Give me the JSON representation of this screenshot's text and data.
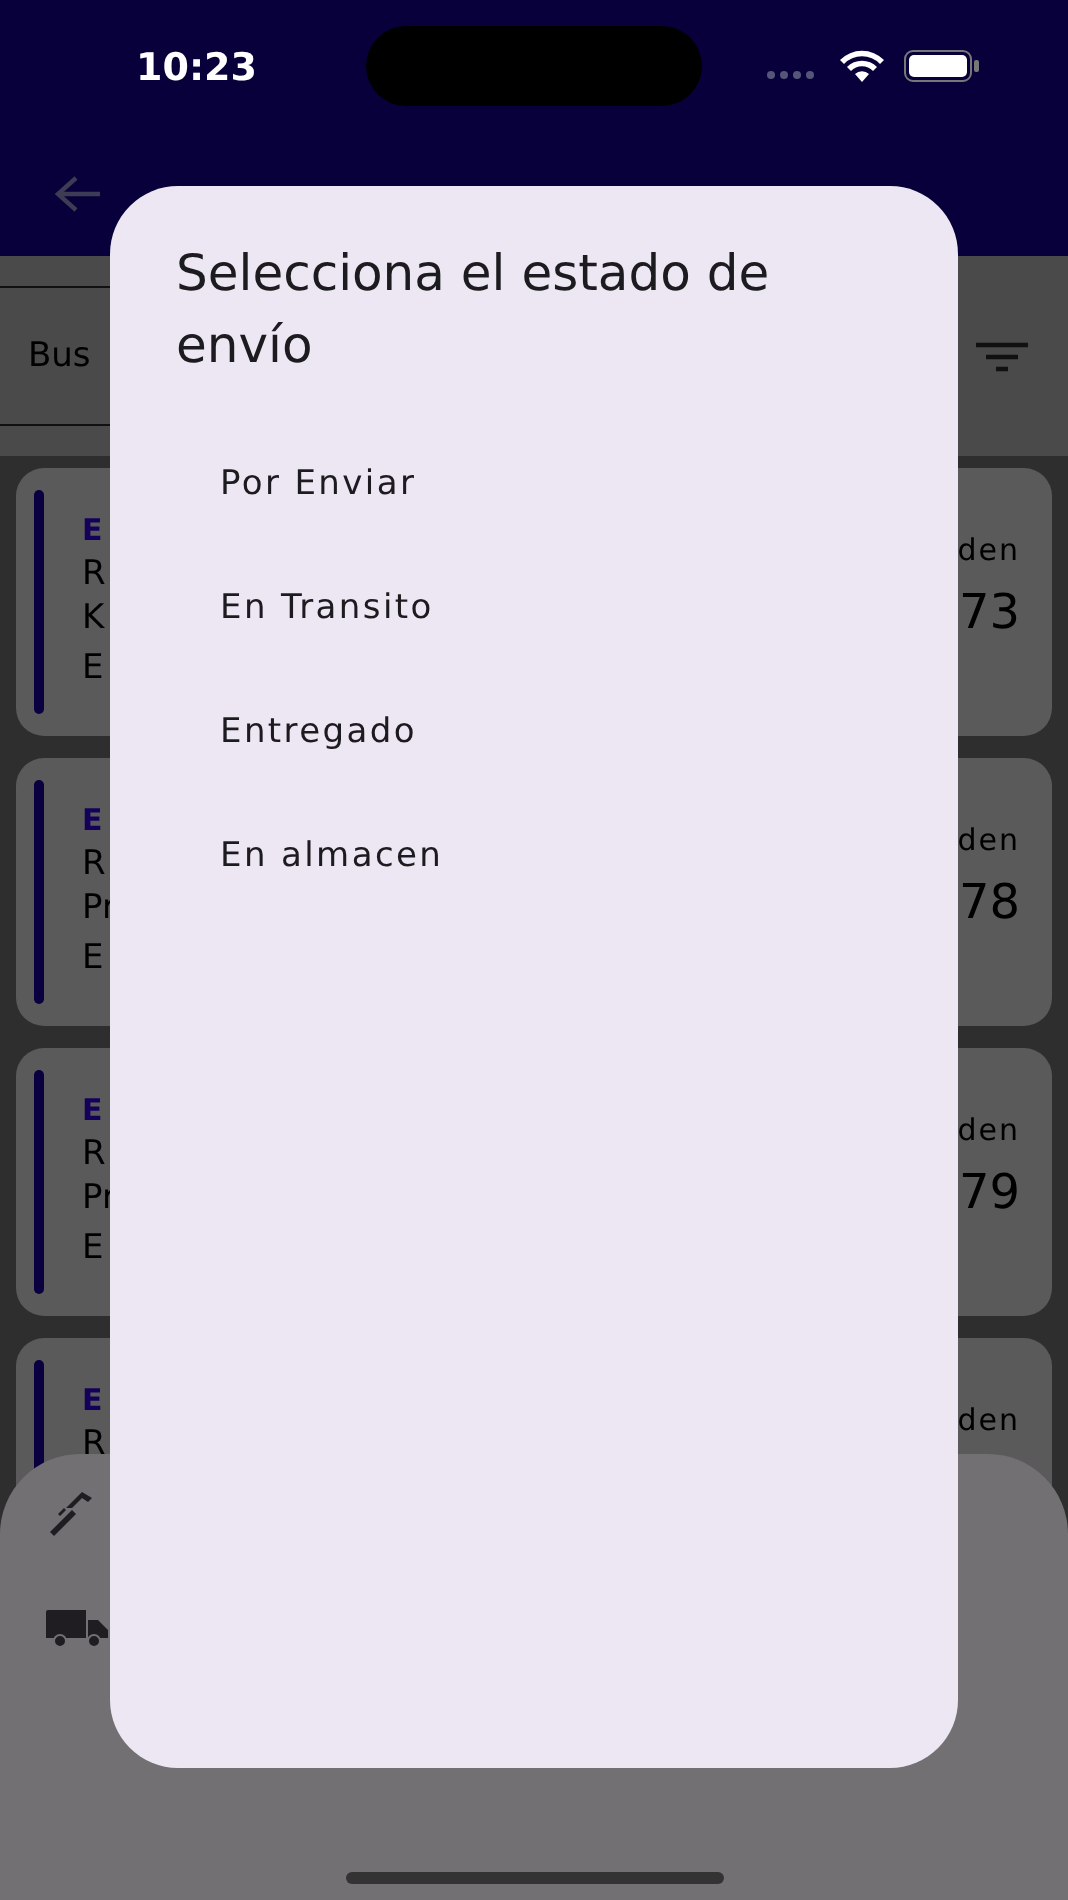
{
  "status_bar": {
    "time": "10:23"
  },
  "search": {
    "placeholder": "Bus"
  },
  "orders": [
    {
      "lines": [
        "E",
        "R",
        "K",
        "E"
      ],
      "label": "den",
      "number": "73"
    },
    {
      "lines": [
        "E",
        "R",
        "Pr",
        "E"
      ],
      "label": "den",
      "number": "78"
    },
    {
      "lines": [
        "E",
        "R",
        "Pr",
        "E"
      ],
      "label": "den",
      "number": "79"
    },
    {
      "lines": [
        "E",
        "R"
      ],
      "label": "den"
    }
  ],
  "bottom_sheet": {
    "items": [
      {
        "kind": "wrench"
      },
      {
        "kind": "truck"
      }
    ]
  },
  "dialog": {
    "title": "Selecciona el estado de envío",
    "options": [
      "Por Enviar",
      "En Transito",
      "Entregado",
      "En almacen"
    ]
  }
}
